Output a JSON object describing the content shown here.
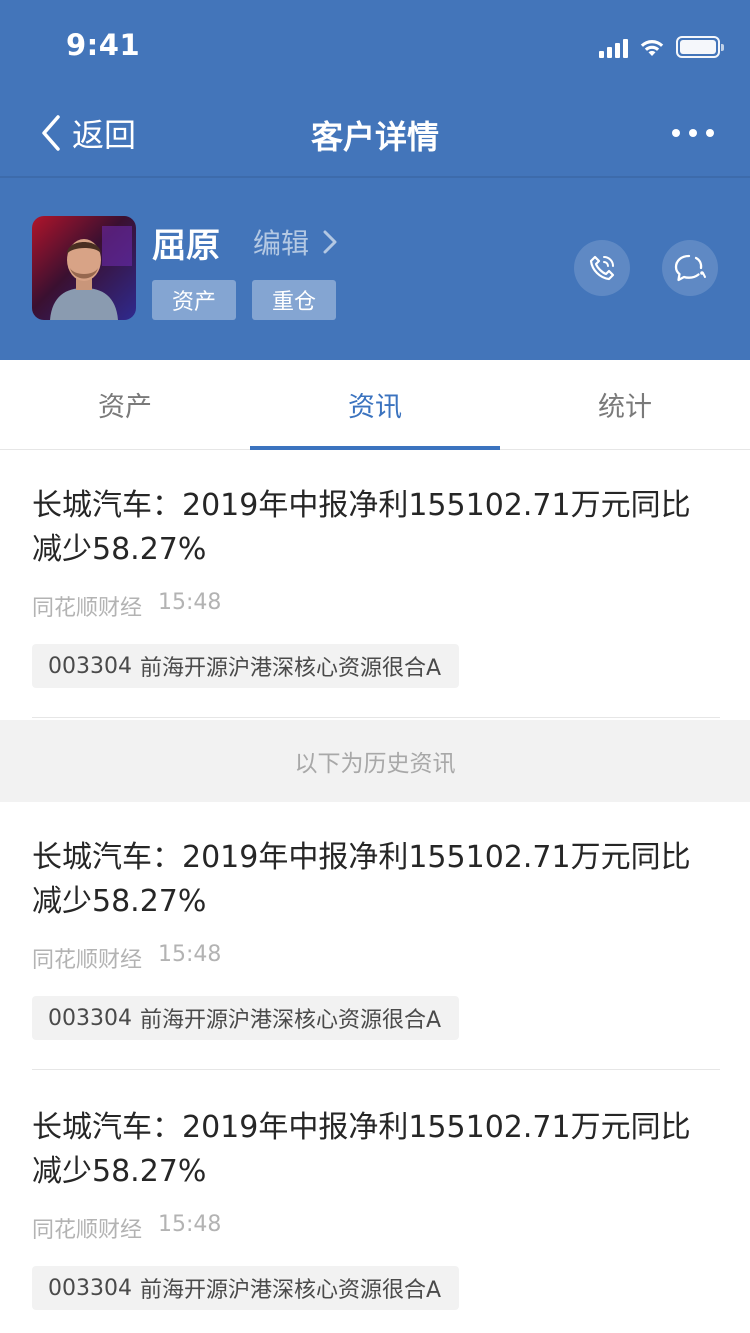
{
  "status_bar": {
    "time": "9:41"
  },
  "nav": {
    "back_label": "返回",
    "title": "客户详情"
  },
  "profile": {
    "name": "屈原",
    "edit_label": "编辑",
    "tags": [
      "资产",
      "重仓"
    ]
  },
  "tabs": [
    {
      "label": "资产",
      "active": false
    },
    {
      "label": "资讯",
      "active": true
    },
    {
      "label": "统计",
      "active": false
    }
  ],
  "history_label": "以下为历史资讯",
  "news": [
    {
      "title": "长城汽车：2019年中报净利155102.71万元同比减少58.27%",
      "source": "同花顺财经",
      "time": "15:48",
      "stock_code": "003304",
      "stock_name": "前海开源沪港深核心资源很合A"
    },
    {
      "title": "长城汽车：2019年中报净利155102.71万元同比减少58.27%",
      "source": "同花顺财经",
      "time": "15:48",
      "stock_code": "003304",
      "stock_name": "前海开源沪港深核心资源很合A"
    },
    {
      "title": "长城汽车：2019年中报净利155102.71万元同比减少58.27%",
      "source": "同花顺财经",
      "time": "15:48",
      "stock_code": "003304",
      "stock_name": "前海开源沪港深核心资源很合A"
    }
  ],
  "colors": {
    "header_bg": "#4375BA",
    "accent": "#3B73BF",
    "history_bg": "#F2F2F2"
  },
  "icons": [
    "chevron-left-icon",
    "more-dots-icon",
    "chevron-right-icon",
    "phone-icon",
    "chat-bubble-icon",
    "signal-icon",
    "wifi-icon",
    "battery-icon"
  ]
}
